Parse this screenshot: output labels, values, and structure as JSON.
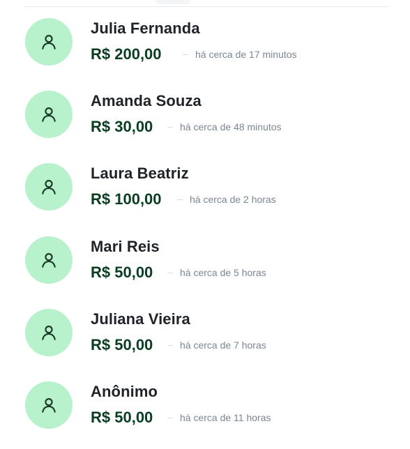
{
  "donations": [
    {
      "name": "Julia Fernanda",
      "amount": "R$  200,00",
      "time": "há cerca de 17 minutos"
    },
    {
      "name": "Amanda Souza",
      "amount": "R$ 30,00",
      "time": "há cerca de 48 minutos"
    },
    {
      "name": "Laura Beatriz",
      "amount": "R$ 100,00",
      "time": "há cerca de 2 horas"
    },
    {
      "name": "Mari Reis",
      "amount": "R$ 50,00",
      "time": "há cerca de 5 horas"
    },
    {
      "name": "Juliana Vieira",
      "amount": "R$ 50,00",
      "time": "há cerca de 7 horas"
    },
    {
      "name": "Anônimo",
      "amount": "R$ 50,00",
      "time": "há cerca de 11 horas"
    }
  ],
  "icons": {
    "avatar": "user-icon"
  },
  "colors": {
    "avatar_bg": "#b8f2cc",
    "amount": "#0b3d22",
    "name": "#1f2327",
    "time": "#7c8592"
  }
}
